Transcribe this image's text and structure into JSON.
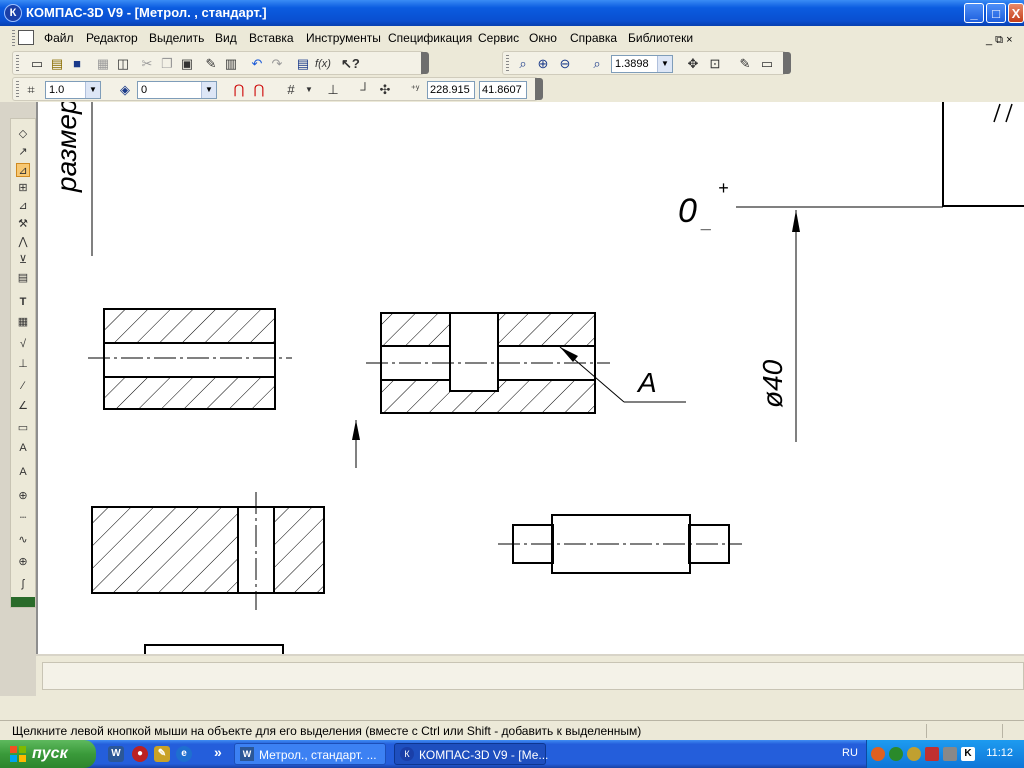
{
  "window": {
    "title": "КОМПАС-3D V9 - [Метрол. , стандарт.]",
    "app_icon": "К",
    "controls": {
      "minimize": "_",
      "maximize": "□",
      "close": "X"
    }
  },
  "menu": {
    "items": [
      "Файл",
      "Редактор",
      "Выделить",
      "Вид",
      "Вставка",
      "Инструменты",
      "Спецификация",
      "Сервис",
      "Окно",
      "Справка",
      "Библиотеки"
    ],
    "mdi_controls": "_ ⧉ ×"
  },
  "toolbar": {
    "zoom_value": "1.3898",
    "step_value": "1.0",
    "layer_value": "0",
    "coord_x": "228.915",
    "coord_y": "41.8607"
  },
  "drawing": {
    "vertical_text": "размер",
    "tolerance_base": "0",
    "tolerance_plus": "+",
    "tolerance_minus": "_",
    "diameter_label": "ø40",
    "callout_label": "A"
  },
  "status": {
    "message": "Щелкните левой кнопкой мыши на объекте для его выделения (вместе с Ctrl или Shift - добавить к выделенным)"
  },
  "taskbar": {
    "start_label": "пуск",
    "tasks": [
      {
        "label": "Метрол., стандарт. ..."
      },
      {
        "label": "КОМПАС-3D V9 - [Ме..."
      }
    ],
    "more": "»",
    "language": "RU",
    "clock": "11:12"
  },
  "colors": {
    "titlebar": "#0a4fd0",
    "taskbar": "#245edb",
    "start": "#3a9a3a",
    "canvas": "#ffffff",
    "chrome": "#ece9d8"
  }
}
